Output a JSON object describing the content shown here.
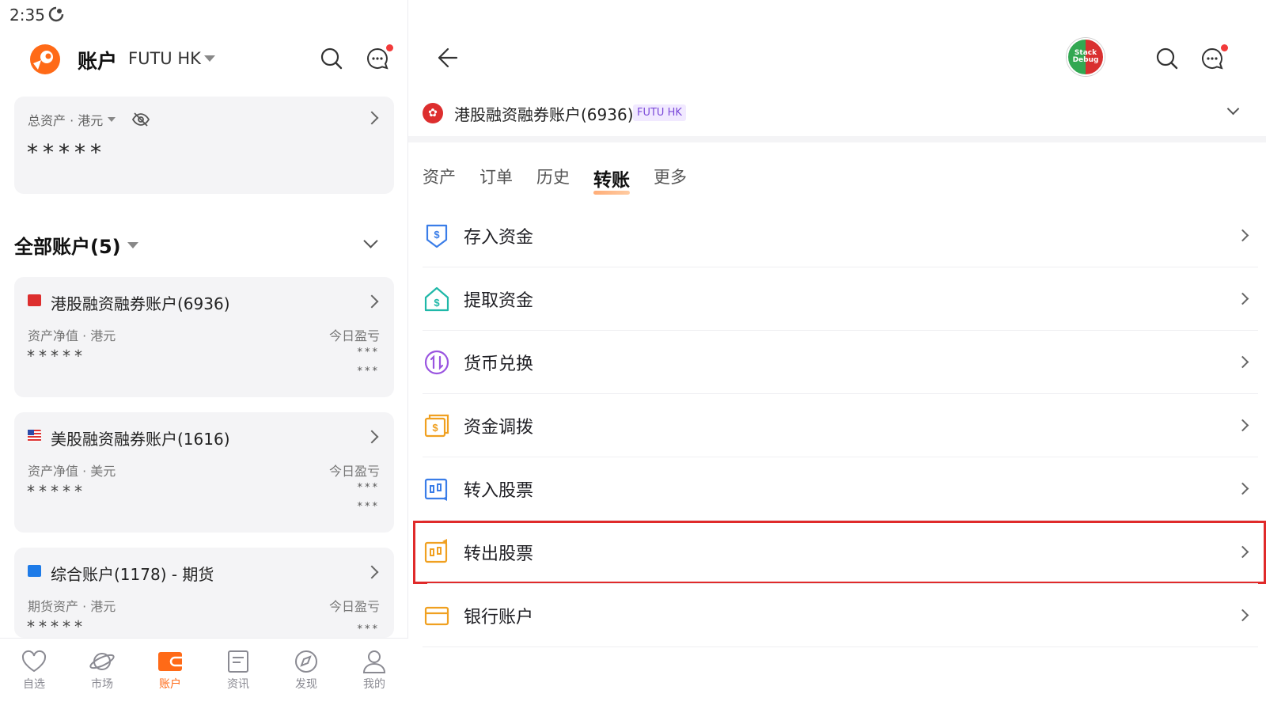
{
  "status_bar": {
    "time": "2:35"
  },
  "left": {
    "app_title": "账户",
    "broker": "FUTU HK",
    "total_card": {
      "label": "总资产 · 港元",
      "value": "*****"
    },
    "all_accounts_title": "全部账户(5)",
    "accounts": [
      {
        "name": "港股融资融券账户(6936)",
        "flag": "hk",
        "left_label": "资产净值 · 港元",
        "right_label": "今日盈亏",
        "stars": "*****",
        "mini1": "***",
        "mini2": "***"
      },
      {
        "name": "美股融资融券账户(1616)",
        "flag": "us",
        "left_label": "资产净值 · 美元",
        "right_label": "今日盈亏",
        "stars": "*****",
        "mini1": "***",
        "mini2": "***"
      },
      {
        "name": "综合账户(1178) - 期货",
        "flag": "futures",
        "left_label": "期货资产 · 港元",
        "right_label": "今日盈亏",
        "stars": "*****",
        "mini1": "***"
      }
    ],
    "bottom_nav": [
      {
        "label": "自选",
        "icon": "heart-icon"
      },
      {
        "label": "市场",
        "icon": "planet-icon"
      },
      {
        "label": "账户",
        "icon": "wallet-icon",
        "active": true
      },
      {
        "label": "资讯",
        "icon": "news-icon"
      },
      {
        "label": "发现",
        "icon": "compass-icon"
      },
      {
        "label": "我的",
        "icon": "user-icon"
      }
    ]
  },
  "right": {
    "account_title": "港股融资融券账户(6936)",
    "broker_tag": "FUTU HK",
    "tabs": [
      "资产",
      "订单",
      "历史",
      "转账",
      "更多"
    ],
    "active_tab": "转账",
    "menu": [
      {
        "label": "存入资金",
        "icon": "deposit-icon",
        "color": "#3a7de8"
      },
      {
        "label": "提取资金",
        "icon": "withdraw-icon",
        "color": "#1fb8a8"
      },
      {
        "label": "货币兑换",
        "icon": "exchange-icon",
        "color": "#9a55e0"
      },
      {
        "label": "资金调拨",
        "icon": "fund-transfer-icon",
        "color": "#f0a020"
      },
      {
        "label": "转入股票",
        "icon": "transfer-in-icon",
        "color": "#3a7de8"
      },
      {
        "label": "转出股票",
        "icon": "transfer-out-icon",
        "color": "#f0a020",
        "highlighted": true
      },
      {
        "label": "银行账户",
        "icon": "bank-card-icon",
        "color": "#f0a020"
      }
    ]
  },
  "colors": {
    "accent": "#ff6a17",
    "highlight": "#e02a2a"
  }
}
